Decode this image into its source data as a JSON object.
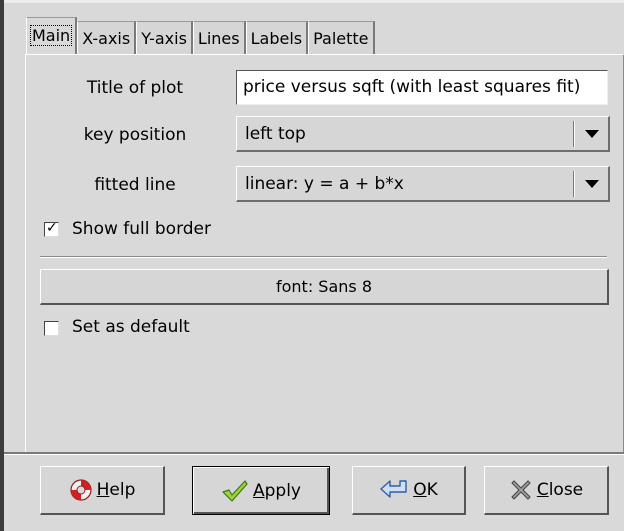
{
  "tabs": [
    {
      "label": "Main",
      "active": true
    },
    {
      "label": "X-axis",
      "active": false
    },
    {
      "label": "Y-axis",
      "active": false
    },
    {
      "label": "Lines",
      "active": false
    },
    {
      "label": "Labels",
      "active": false
    },
    {
      "label": "Palette",
      "active": false
    }
  ],
  "main": {
    "title_label": "Title of plot",
    "title_value": "price versus sqft (with least squares fit)",
    "key_label": "key position",
    "key_value": "left top",
    "fitted_label": "fitted line",
    "fitted_value": "linear: y = a + b*x",
    "show_border_label": "Show full border",
    "show_border_checked": true,
    "font_button": "font: Sans 8",
    "default_label": "Set as default",
    "default_checked": false
  },
  "buttons": {
    "help": {
      "mnemonic": "H",
      "rest": "elp",
      "icon": "lifebuoy-icon"
    },
    "apply": {
      "mnemonic": "A",
      "rest": "pply",
      "icon": "checkmark-icon"
    },
    "ok": {
      "mnemonic": "O",
      "rest": "K",
      "icon": "return-arrow-icon"
    },
    "close": {
      "mnemonic": "C",
      "rest": "lose",
      "icon": "close-x-icon"
    }
  }
}
